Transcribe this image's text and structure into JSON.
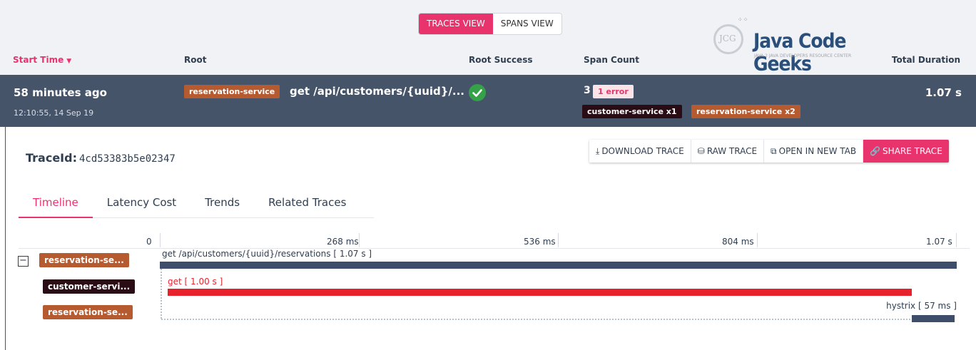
{
  "view_toggle": {
    "traces": "TRACES VIEW",
    "spans": "SPANS VIEW"
  },
  "logo": {
    "ring": "JCG",
    "word_a": "Java ",
    "word_b": "Code Geeks",
    "tagline": "JAVA 2 JAVA DEVELOPERS RESOURCE CENTER"
  },
  "columns": {
    "start_time": "Start Time",
    "root": "Root",
    "root_success": "Root Success",
    "span_count": "Span Count",
    "total_duration": "Total Duration"
  },
  "trace_row": {
    "ago": "58 minutes ago",
    "date": "12:10:55, 14 Sep 19",
    "service": "reservation-service",
    "endpoint": "get /api/customers/{uuid}/...",
    "span_count": "3",
    "error_badge": "1 error",
    "service_counts": [
      "customer-service x1",
      "reservation-service x2"
    ],
    "total": "1.07 s"
  },
  "details": {
    "traceid_label": "TraceId:",
    "traceid_value": "4cd53383b5e02347",
    "actions": {
      "download": "DOWNLOAD TRACE",
      "raw": "RAW TRACE",
      "open": "OPEN IN NEW TAB",
      "share": "SHARE TRACE"
    },
    "tabs": [
      "Timeline",
      "Latency Cost",
      "Trends",
      "Related Traces"
    ]
  },
  "timeline": {
    "ticks": [
      "0",
      "268 ms",
      "536 ms",
      "804 ms",
      "1.07 s"
    ],
    "services": [
      "reservation-se...",
      "customer-servi...",
      "reservation-se..."
    ],
    "spans": [
      {
        "label": "get /api/customers/{uuid}/reservations [ 1.07 s ]",
        "color": "#3d4d6a"
      },
      {
        "label": "get [ 1.00 s ]",
        "color": "#e8222d"
      },
      {
        "label": "hystrix [ 57 ms ]",
        "color": "#3d4d6a"
      }
    ]
  },
  "colors": {
    "accent": "#e8336d",
    "row_bg": "#46546a",
    "service_reservation": "#b65a30",
    "service_customer": "#2a0c14",
    "success": "#35a149"
  }
}
